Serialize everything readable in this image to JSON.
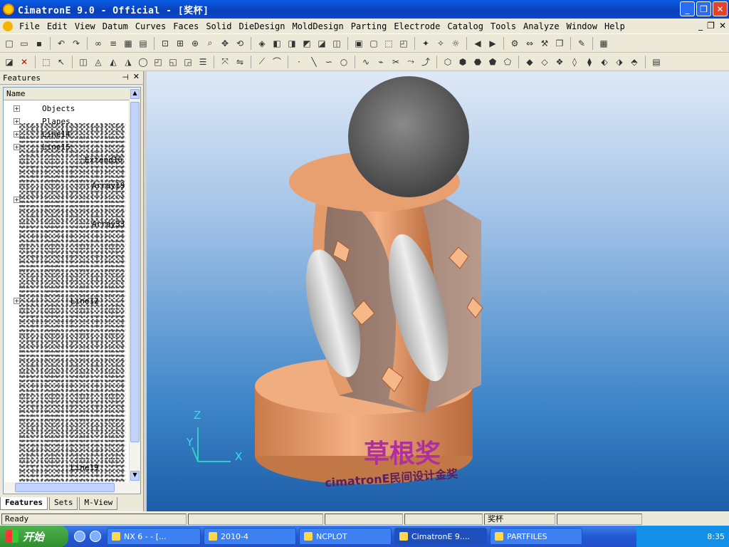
{
  "window": {
    "title": "CimatronE 9.0 - Official - [奖杯]",
    "buttons": [
      "_",
      "❐",
      "✕"
    ]
  },
  "menu": [
    "File",
    "Edit",
    "View",
    "Datum",
    "Curves",
    "Faces",
    "Solid",
    "DieDesign",
    "MoldDesign",
    "Parting",
    "Electrode",
    "Catalog",
    "Tools",
    "Analyze",
    "Window",
    "Help"
  ],
  "mdi_buttons": [
    "_",
    "❐",
    "✕"
  ],
  "panel": {
    "title": "Features",
    "column": "Name",
    "nodes": [
      {
        "label": "Objects",
        "expandable": true
      },
      {
        "label": "Planes",
        "expandable": true
      },
      {
        "label": "Line14",
        "expandable": true
      },
      {
        "label": "Line15",
        "expandable": true
      },
      {
        "label": "Extend16",
        "expandable": false
      },
      {
        "label": "Array19",
        "expandable": false
      },
      {
        "label": "Array33",
        "expandable": true
      },
      {
        "label": "Line12",
        "expandable": true
      },
      {
        "label": "Line19",
        "expandable": false
      }
    ],
    "tabs": [
      "Features",
      "Sets",
      "M-View"
    ]
  },
  "viewport": {
    "axis_z": "Z",
    "axis_y": "Y",
    "axis_x": "X",
    "trophy_text": "草根奖",
    "trophy_subtext": "cimatronE民间设计金奖"
  },
  "status": {
    "left": "Ready",
    "part": "奖杯"
  },
  "taskbar": {
    "start": "开始",
    "tasks": [
      "NX 6 - - [...",
      "2010-4",
      "NCPLOT",
      "CimatronE 9....",
      "PARTFILES"
    ],
    "clock": "8:35"
  }
}
